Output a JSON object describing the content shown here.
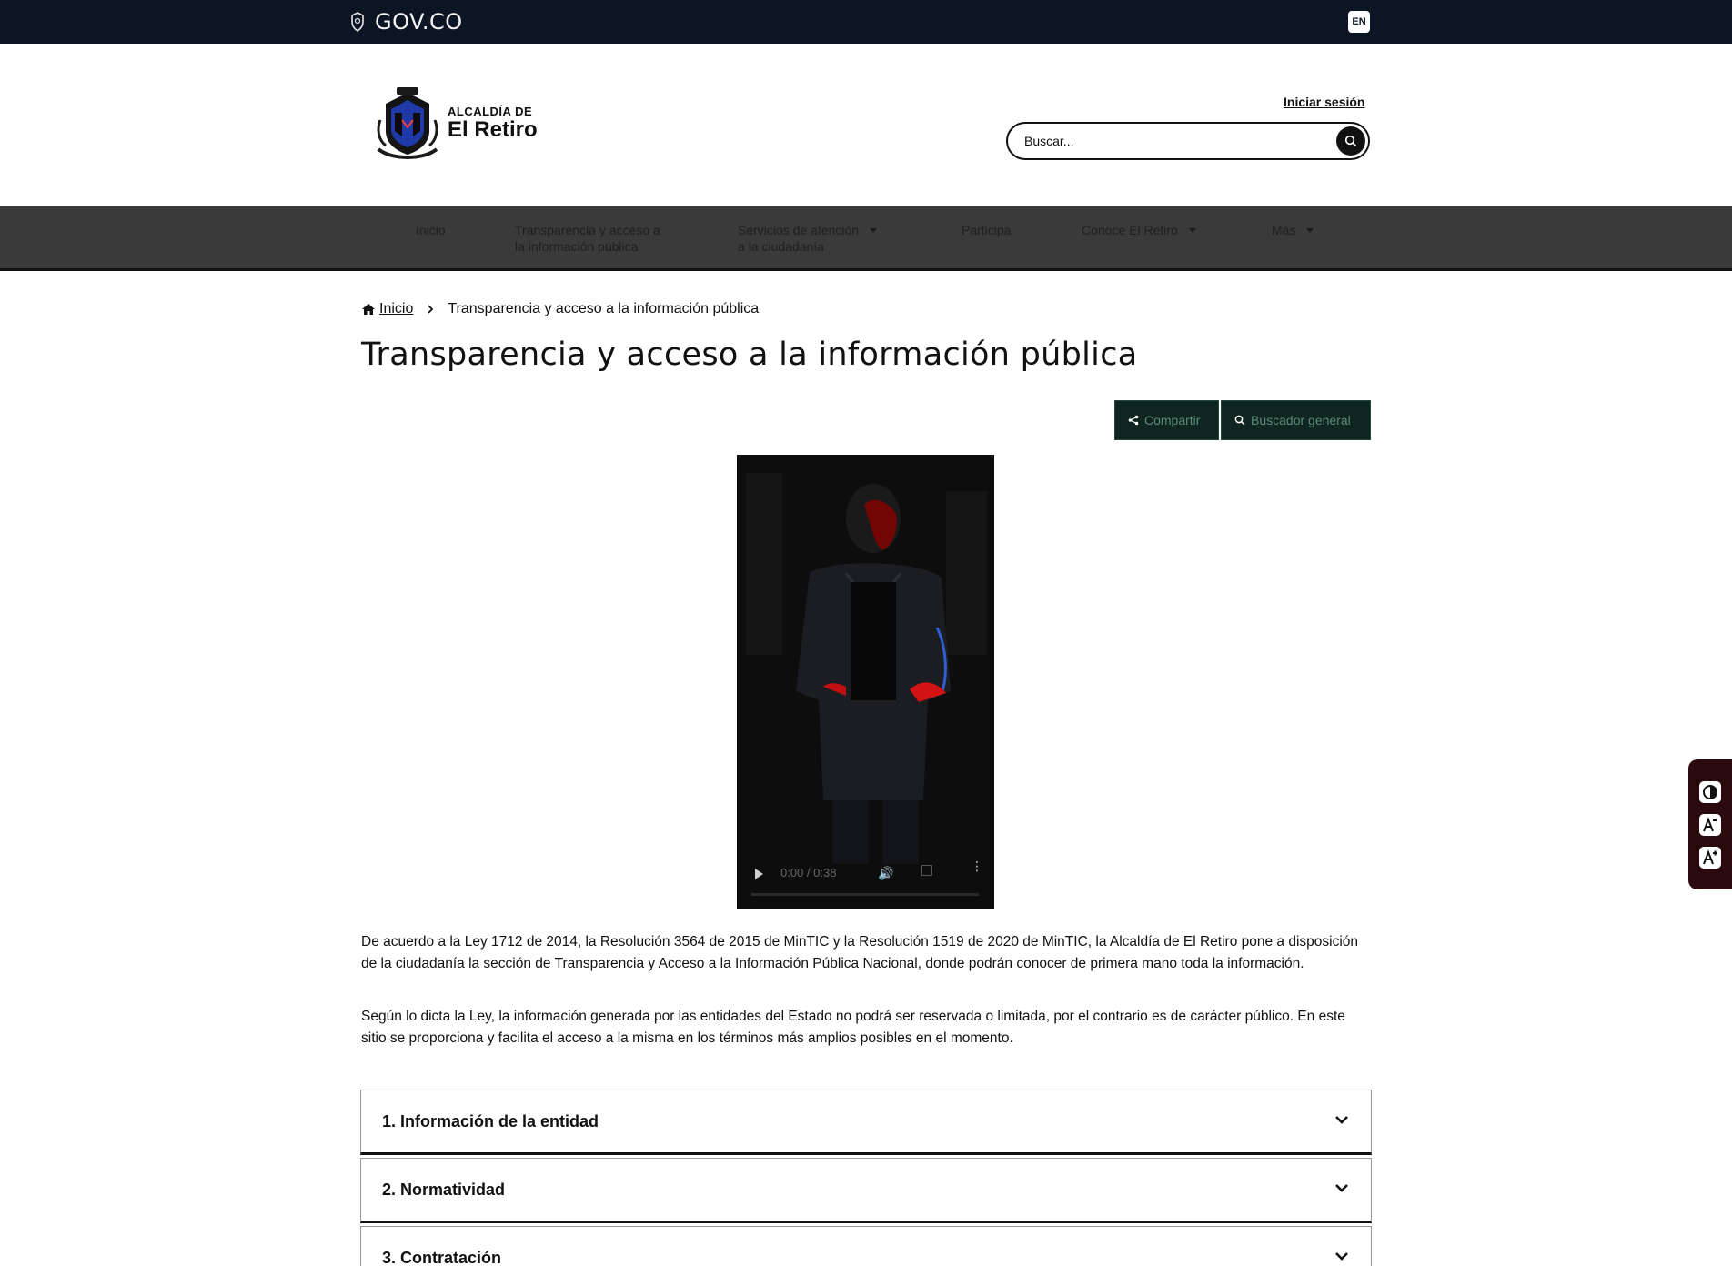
{
  "govbar": {
    "brand": "GOV.CO",
    "lang": "EN"
  },
  "header": {
    "logo_top": "ALCALDÍA DE",
    "logo_name": "El Retiro",
    "login": "Iniciar sesión",
    "search_placeholder": "Buscar..."
  },
  "nav": {
    "items": [
      {
        "label_line1": "Inicio",
        "label_line2": ""
      },
      {
        "label_line1": "Transparencia y acceso a",
        "label_line2": "la información pública"
      },
      {
        "label_line1": "Servicios de atención",
        "label_line2": "a la ciudadanía"
      },
      {
        "label_line1": "Participa",
        "label_line2": ""
      },
      {
        "label_line1": "Conoce El Retiro",
        "label_line2": ""
      },
      {
        "label_line1": "Más",
        "label_line2": ""
      }
    ]
  },
  "breadcrumb": {
    "home": "Inicio",
    "current": "Transparencia y acceso a la información pública"
  },
  "page_title": "Transparencia y acceso a la información pública",
  "actions": {
    "share": "Compartir",
    "search": "Buscador general"
  },
  "video": {
    "time": "0:00 / 0:38"
  },
  "paragraphs": [
    "De acuerdo a la Ley 1712 de 2014, la Resolución 3564 de 2015 de MinTIC y la Resolución 1519 de 2020 de MinTIC, la Alcaldía de El Retiro pone a disposición de la ciudadanía la sección de Transparencia y Acceso a la Información Pública Nacional, donde podrán conocer de primera mano toda la información.",
    "Según lo dicta la Ley, la información generada por las entidades del Estado no podrá ser reservada o limitada, por el contrario es de carácter público. En este sitio se proporciona y facilita el acceso a la misma en los términos más amplios posibles en el momento."
  ],
  "accordion": [
    {
      "label": "1. Información de la entidad"
    },
    {
      "label": "2. Normatividad"
    },
    {
      "label": "3. Contratación"
    }
  ],
  "icons": {
    "contrast": "contrast-icon",
    "decrease_text": "decrease-text-icon",
    "increase_text": "increase-text-icon"
  }
}
